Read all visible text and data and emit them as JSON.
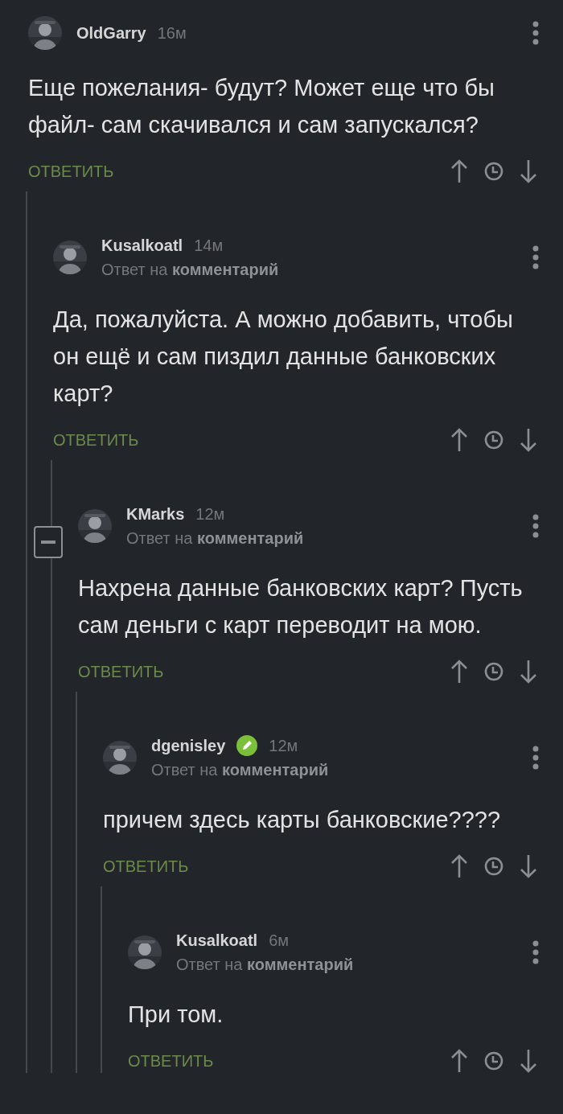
{
  "comments": [
    {
      "author": "OldGarry",
      "time": "16м",
      "text": "Еще пожелания- будут? Может еще что бы файл- сам скачивался и сам запускался?",
      "reply_label": "ОТВЕТИТЬ",
      "children": [
        {
          "author": "Kusalkoatl",
          "time": "14м",
          "reply_to": "Ответ на **комментарий**",
          "text": "Да, пожалуйста. А можно добавить, чтобы он ещё и сам пиздил данные банковских карт?",
          "reply_label": "ОТВЕТИТЬ",
          "children": [
            {
              "author": "KMarks",
              "time": "12м",
              "collapse_toggle": true,
              "reply_to": "Ответ на **комментарий**",
              "text": "Нахрена данные банковских карт? Пусть сам деньги с карт переводит на мою.",
              "reply_label": "ОТВЕТИТЬ",
              "children": [
                {
                  "author": "dgenisley",
                  "time": "12м",
                  "verified": true,
                  "reply_to": "Ответ на **комментарий**",
                  "text": "причем здесь карты банковские????",
                  "reply_label": "ОТВЕТИТЬ",
                  "children": [
                    {
                      "author": "Kusalkoatl",
                      "time": "6м",
                      "reply_to": "Ответ на **комментарий**",
                      "text": "При том.",
                      "reply_label": "ОТВЕТИТЬ"
                    }
                  ]
                }
              ]
            }
          ]
        }
      ]
    }
  ]
}
